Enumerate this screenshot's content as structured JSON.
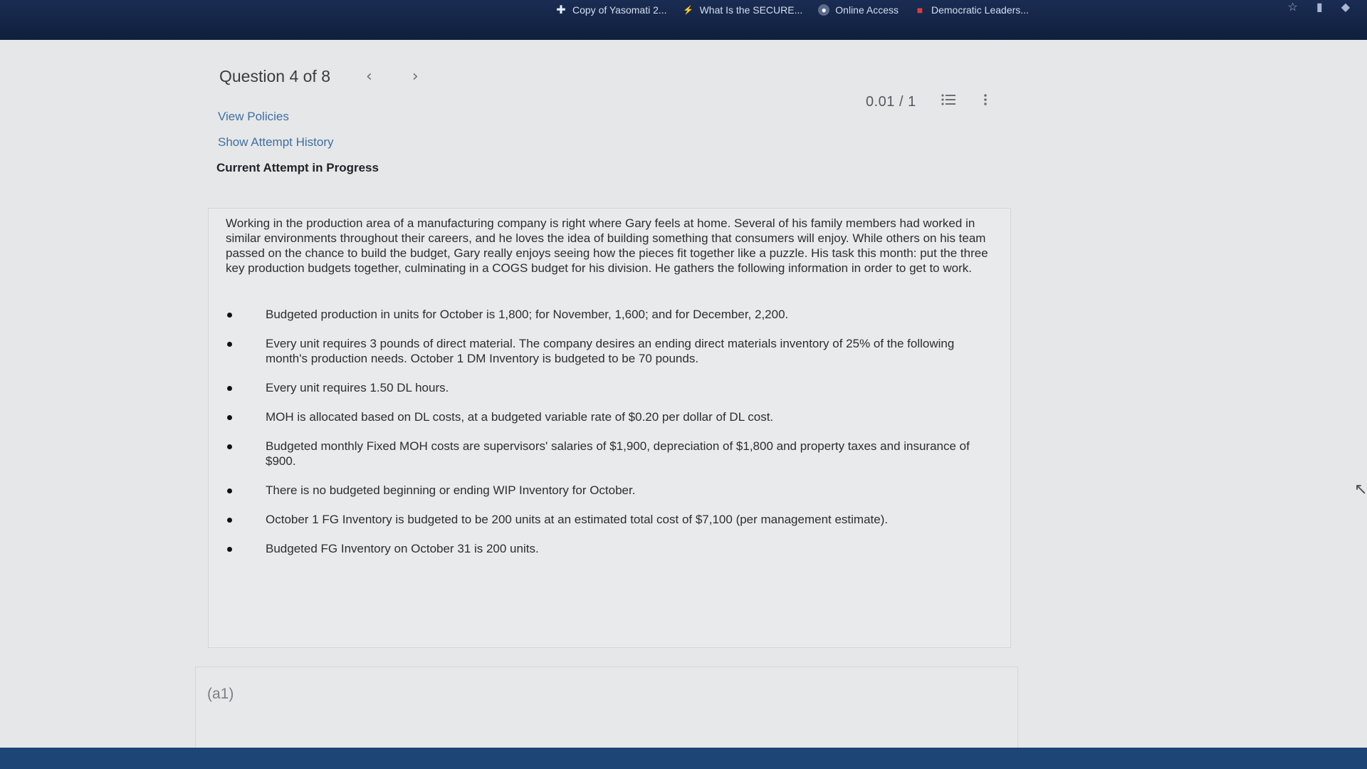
{
  "browser": {
    "bookmarks": [
      {
        "label": "Copy of Yasomati 2...",
        "icon": "plus-icon"
      },
      {
        "label": "What Is the SECURE...",
        "icon": "spark-icon"
      },
      {
        "label": "Online Access",
        "icon": "globe-icon"
      },
      {
        "label": "Democratic Leaders...",
        "icon": "flag-icon"
      }
    ]
  },
  "question": {
    "title": "Question 4 of 8",
    "prev_glyph": "‹",
    "next_glyph": "›",
    "score": "0.01 / 1",
    "links": {
      "view_policies": "View Policies",
      "show_attempt_history": "Show Attempt History"
    },
    "status": "Current Attempt in Progress",
    "text": "Working in the production area of a manufacturing company is right where Gary feels at home. Several of his family members had worked in similar environments throughout their careers, and he loves the idea of building something that consumers will enjoy. While others on his team passed on the chance to build the budget, Gary really enjoys seeing how the pieces fit together like a puzzle. His task this month: put the three key production budgets together, culminating in a COGS budget for his division. He gathers the following information in order to get to work.",
    "bullets": [
      "Budgeted production in units for October is 1,800; for November, 1,600; and for December, 2,200.",
      "Every unit requires 3 pounds of direct material. The company desires an ending direct materials inventory of 25% of the following month's production needs. October 1 DM Inventory is budgeted to be 70 pounds.",
      "Every unit requires 1.50 DL hours.",
      "MOH is allocated based on DL costs, at a budgeted variable rate of $0.20 per dollar of DL cost.",
      "Budgeted monthly Fixed MOH costs are supervisors' salaries of $1,900, depreciation of $1,800 and property taxes and insurance of $900.",
      "There is no budgeted beginning or ending WIP Inventory for October.",
      "October 1 FG Inventory is budgeted to be 200 units at an estimated total cost of $7,100 (per management estimate).",
      "Budgeted FG Inventory on October 31 is 200 units."
    ],
    "part_label": "(a1)"
  }
}
